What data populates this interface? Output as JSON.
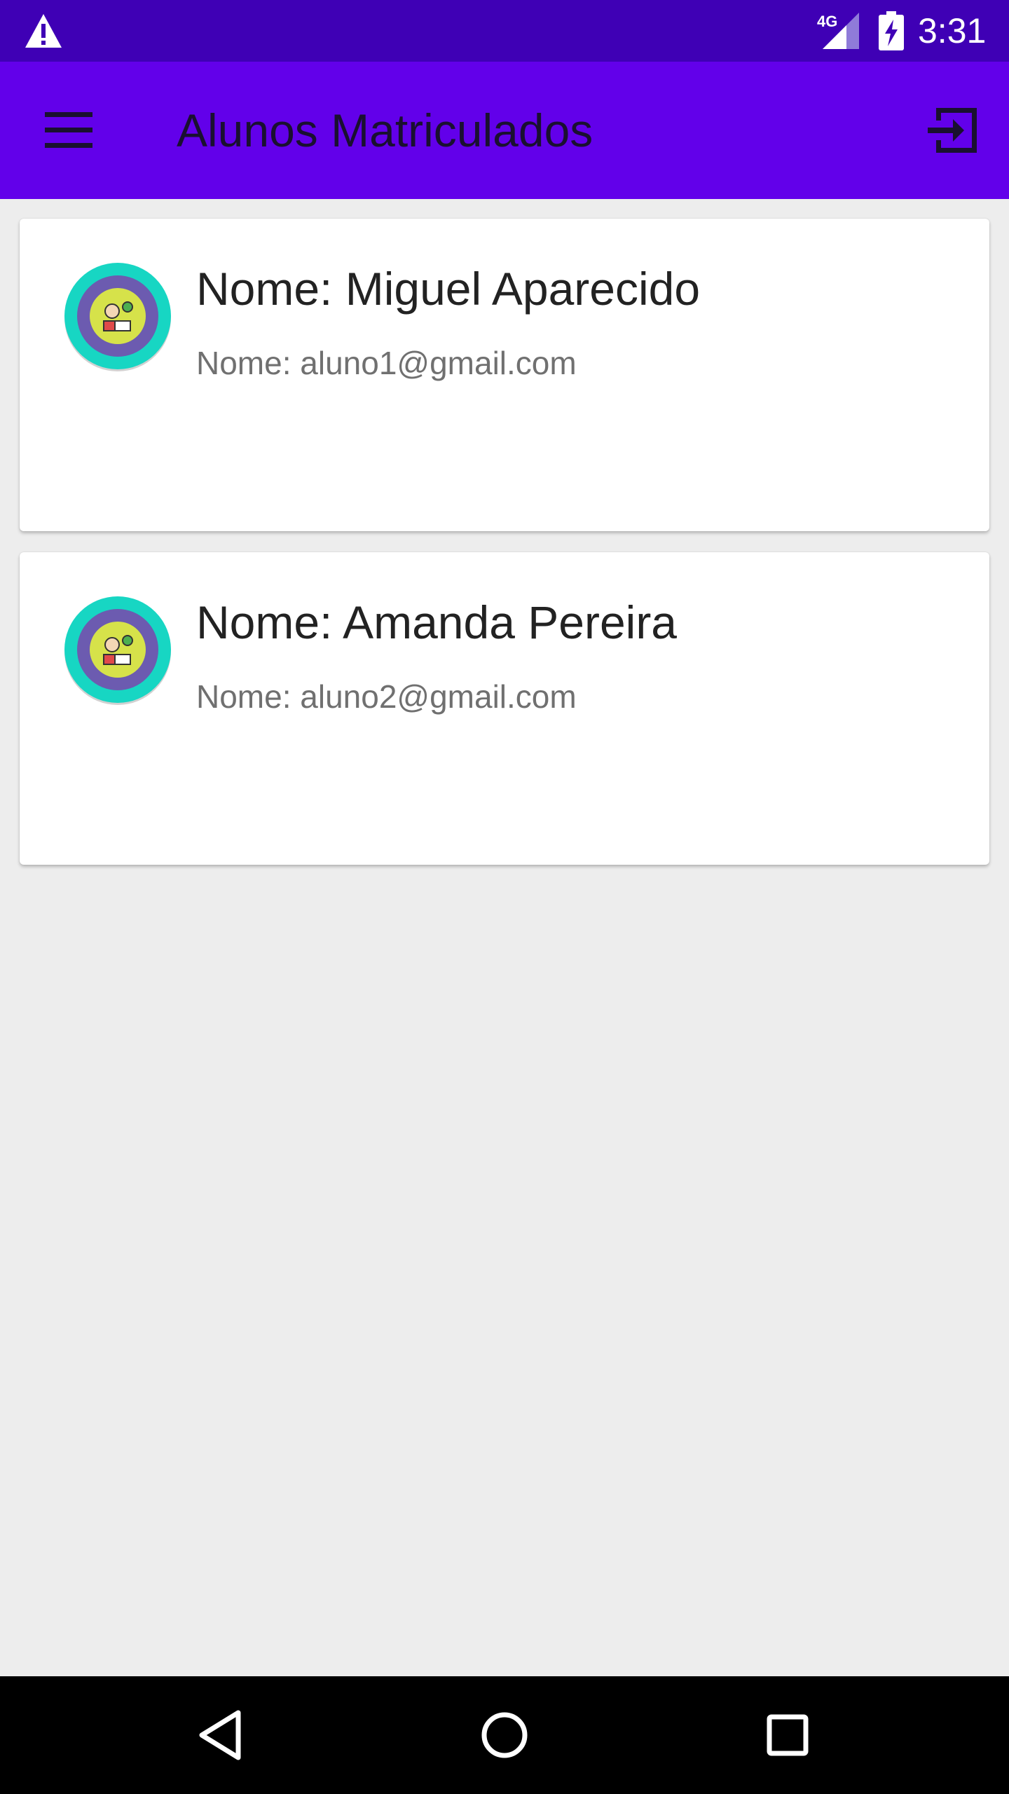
{
  "status_bar": {
    "network_label": "4G",
    "time": "3:31",
    "icons": [
      "warning-icon",
      "signal-icon",
      "battery-charging-icon"
    ]
  },
  "app_bar": {
    "title": "Alunos Matriculados",
    "menu_icon": "hamburger-menu-icon",
    "action_icon": "logout-icon"
  },
  "students": [
    {
      "name": "Nome: Miguel Aparecido",
      "email": "Nome: aluno1@gmail.com",
      "avatar_icon": "student-avatar-icon"
    },
    {
      "name": "Nome: Amanda Pereira",
      "email": "Nome: aluno2@gmail.com",
      "avatar_icon": "student-avatar-icon"
    }
  ],
  "nav_bar": {
    "buttons": [
      "back-icon",
      "home-icon",
      "recents-icon"
    ]
  },
  "colors": {
    "status_bar": "#3f00b5",
    "app_bar": "#6200ea",
    "background": "#ededed",
    "avatar_ring": "#17d6c3",
    "avatar_inner_ring": "#6c5bb0",
    "avatar_center": "#d6e24a"
  }
}
